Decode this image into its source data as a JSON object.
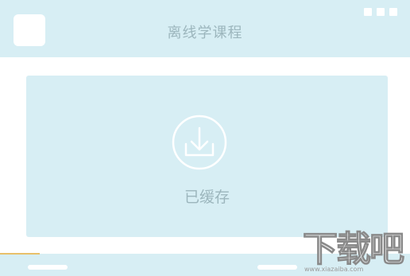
{
  "header": {
    "title": "离线学课程"
  },
  "card": {
    "label": "已缓存",
    "icon": "download-icon"
  },
  "colors": {
    "panel": "#d7eef4",
    "text": "#9cb6bd",
    "accent": "#e8c06a"
  },
  "watermark": {
    "logo": "下载吧",
    "url": "www.xiazaiba.com"
  }
}
